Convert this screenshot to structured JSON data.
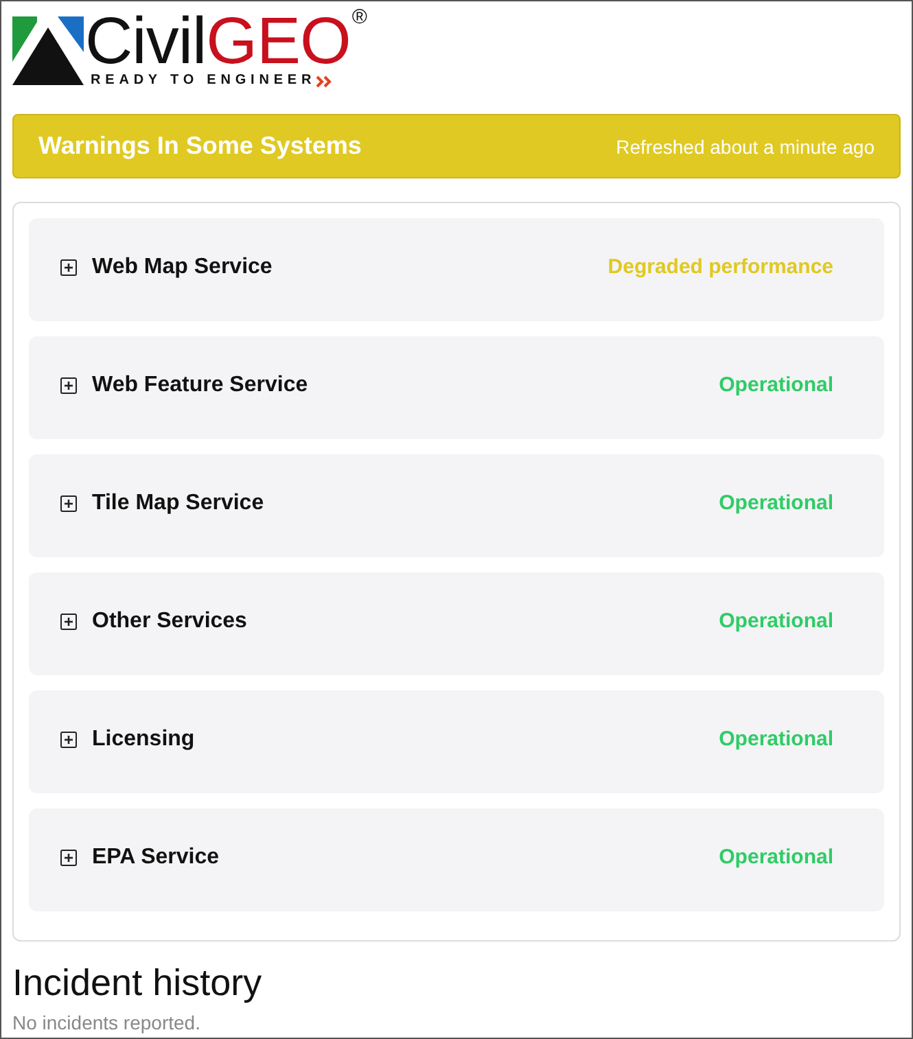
{
  "logo": {
    "name_dark": "Civil",
    "name_accent": "GEO",
    "registered": "®",
    "tagline": "READY TO ENGINEER"
  },
  "banner": {
    "title": "Warnings In Some Systems",
    "refreshed": "Refreshed about a minute ago"
  },
  "components": [
    {
      "name": "Web Map Service",
      "status": "Degraded performance",
      "color": "#e0c922",
      "expanded": false
    },
    {
      "name": "Web Feature Service",
      "status": "Operational",
      "color": "#2fcc66",
      "expanded": false
    },
    {
      "name": "Tile Map Service",
      "status": "Operational",
      "color": "#2fcc66",
      "expanded": false
    },
    {
      "name": "Other Services",
      "status": "Operational",
      "color": "#2fcc66",
      "expanded": false
    },
    {
      "name": "Licensing",
      "status": "Operational",
      "color": "#2fcc66",
      "expanded": false
    },
    {
      "name": "EPA Service",
      "status": "Operational",
      "color": "#2fcc66",
      "expanded": false
    }
  ],
  "incident_history": {
    "heading": "Incident history",
    "message": "No incidents reported."
  }
}
